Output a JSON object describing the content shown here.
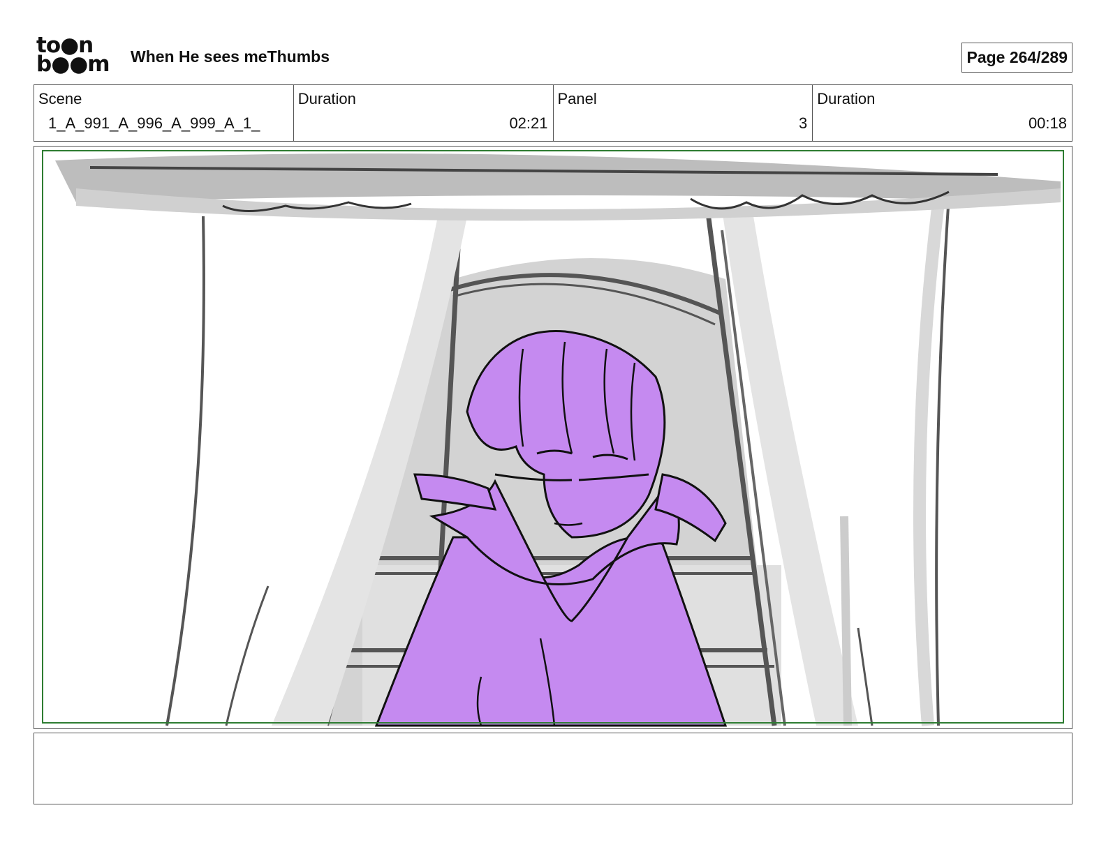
{
  "header": {
    "logo_line1": "to●n",
    "logo_line2": "b●●m",
    "project_title": "When He sees meThumbs",
    "page_label": "Page 264/289"
  },
  "info": {
    "scene_label": "Scene",
    "scene_value": "1_A_991_A_996_A_999_A_1_",
    "scene_duration_label": "Duration",
    "scene_duration_value": "02:21",
    "panel_label": "Panel",
    "panel_value": "3",
    "panel_duration_label": "Duration",
    "panel_duration_value": "00:18"
  },
  "panel": {
    "colors": {
      "character_fill": "#c58af0",
      "line": "#111111",
      "curtain_gray": "#cfcfcf",
      "window_gray": "#d3d3d3",
      "frame_dark": "#666666",
      "safe_area": "#2e7d32"
    }
  },
  "notes": {
    "text": ""
  }
}
